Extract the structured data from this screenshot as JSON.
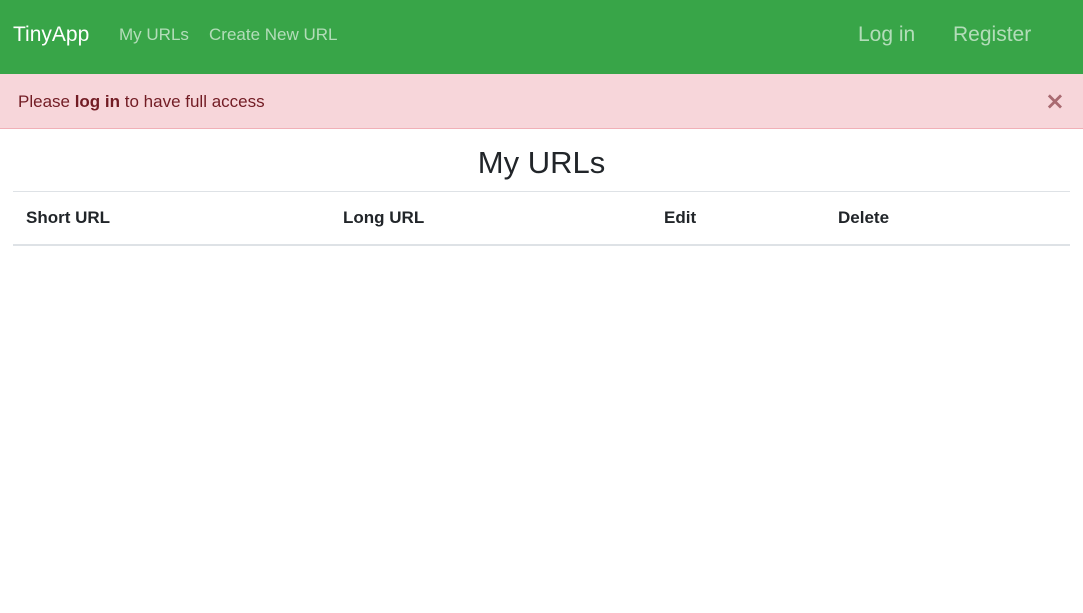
{
  "navbar": {
    "brand": "TinyApp",
    "links": [
      "My URLs",
      "Create New URL"
    ],
    "login_label": "Log in",
    "register_label": "Register",
    "background_color": "#38a548"
  },
  "alert": {
    "prefix": "Please ",
    "link_text": "log in",
    "suffix": " to have full access",
    "close_symbol": "×",
    "background_color": "#f7d6da",
    "text_color": "#721c24"
  },
  "main": {
    "title": "My URLs",
    "table": {
      "columns": [
        "Short URL",
        "Long URL",
        "Edit",
        "Delete"
      ],
      "rows": []
    }
  }
}
